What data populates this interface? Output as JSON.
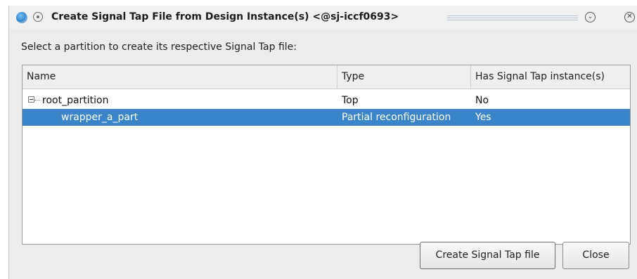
{
  "window": {
    "title": "Create Signal Tap File from Design Instance(s) <@sj-iccf0693>"
  },
  "prompt": "Select a partition to create its respective Signal Tap file:",
  "table": {
    "columns": [
      "Name",
      "Type",
      "Has Signal Tap instance(s)"
    ],
    "rows": [
      {
        "name": "root_partition",
        "type": "Top",
        "has_signal_tap": "No",
        "expanded": true
      },
      {
        "name": "wrapper_a_part",
        "type": "Partial reconfiguration",
        "has_signal_tap": "Yes",
        "selected": true
      }
    ]
  },
  "buttons": {
    "create": "Create Signal Tap file",
    "close": "Close"
  },
  "colors": {
    "selection": "#3a84c9"
  },
  "icons": {
    "app": "signal-tap-app-icon",
    "window_menu": "window-menu-icon",
    "minimize": "chevron-down-circle-icon",
    "close": "close-circle-icon",
    "expander": "tree-collapse-icon"
  }
}
